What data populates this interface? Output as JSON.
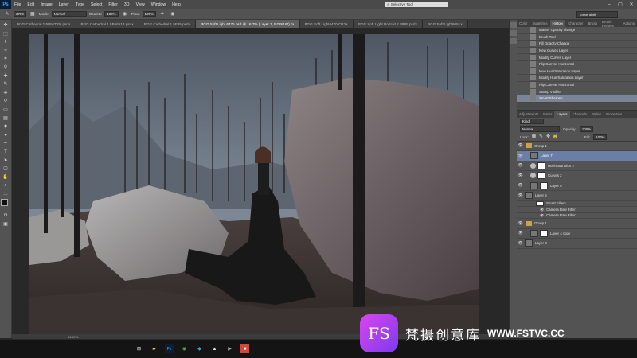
{
  "app": {
    "logo": "Ps",
    "search_placeholder": "Selective Tool"
  },
  "menu": [
    "File",
    "Edit",
    "Image",
    "Layer",
    "Type",
    "Select",
    "Filter",
    "3D",
    "View",
    "Window",
    "Help"
  ],
  "window_controls": [
    "–",
    "▢",
    "✕"
  ],
  "options": {
    "brush_size": "3700",
    "mode_label": "Mode:",
    "mode_value": "Normal",
    "opacity_label": "Opacity:",
    "opacity_value": "100%",
    "flow_label": "Flow:",
    "flow_value": "100%",
    "workspace": "Essentials"
  },
  "tabs": [
    {
      "label": "BGG Cathedral 1 5B56T3ts.psd",
      "active": false
    },
    {
      "label": "BGG Cathedral 1 5B56513.psd",
      "active": false
    },
    {
      "label": "BGG Cathedral 1 5F35.psd",
      "active": false
    },
    {
      "label": "BGG Soft Light 6475.psd @ 16.7% (Layer 7, RGB/16*) *",
      "active": true
    },
    {
      "label": "BGG Soft Light6470.CR2",
      "active": false
    },
    {
      "label": "BGG Soft Light Portrait 2 5B85.psd",
      "active": false
    },
    {
      "label": "BGG Soft Light6051",
      "active": false
    }
  ],
  "status": {
    "zoom": "16.67%"
  },
  "history_panel": {
    "tabs": [
      "Color",
      "Swatches",
      "History",
      "Character",
      "Brush",
      "Brush Presets",
      "Actions"
    ],
    "active_tab": "History",
    "items": [
      {
        "label": "Master Opacity change",
        "selected": false
      },
      {
        "label": "Brush Tool",
        "selected": false
      },
      {
        "label": "Fill Opacity Change",
        "selected": false
      },
      {
        "label": "New Curves Layer",
        "selected": false
      },
      {
        "label": "Modify Curves Layer",
        "selected": false
      },
      {
        "label": "Flip Canvas Horizontal",
        "selected": false
      },
      {
        "label": "New Hue/Saturation Layer",
        "selected": false
      },
      {
        "label": "Modify Hue/Saturation Layer",
        "selected": false
      },
      {
        "label": "Flip Canvas Horizontal",
        "selected": false
      },
      {
        "label": "Stamp Visible",
        "selected": false
      },
      {
        "label": "Smart Sharpen",
        "selected": true
      }
    ]
  },
  "layers_panel": {
    "tabs": [
      "Adjustments",
      "Paths",
      "Layers",
      "Channels",
      "Styles",
      "Properties"
    ],
    "active_tab": "Layers",
    "kind": "Kind",
    "blend_mode": "Normal",
    "opacity_label": "Opacity:",
    "opacity_value": "100%",
    "lock_label": "Lock:",
    "fill_label": "Fill:",
    "fill_value": "100%",
    "layers": [
      {
        "name": "Group 1",
        "type": "group",
        "indent": 0,
        "selected": false
      },
      {
        "name": "Layer 7",
        "type": "pixel",
        "indent": 1,
        "selected": true
      },
      {
        "name": "Hue/Saturation 2",
        "type": "adjustment",
        "indent": 1,
        "selected": false
      },
      {
        "name": "Curves 2",
        "type": "adjustment",
        "indent": 1,
        "selected": false
      },
      {
        "name": "Layer 6",
        "type": "pixel-mask",
        "indent": 1,
        "selected": false
      },
      {
        "name": "Layer 5",
        "type": "pixel",
        "indent": 0,
        "selected": false
      },
      {
        "name": "Smart Filters",
        "type": "sub",
        "indent": 2,
        "selected": false
      },
      {
        "name": "Camera Raw Filter",
        "type": "subfilter",
        "indent": 3,
        "selected": false
      },
      {
        "name": "Camera Raw Filter",
        "type": "subfilter",
        "indent": 3,
        "selected": false
      },
      {
        "name": "Group 1",
        "type": "group",
        "indent": 0,
        "selected": false
      },
      {
        "name": "Layer 4 copy",
        "type": "pixel-mask",
        "indent": 1,
        "selected": false
      },
      {
        "name": "Layer 3",
        "type": "pixel",
        "indent": 0,
        "selected": false
      }
    ]
  },
  "taskbar_icons": [
    "windows-start",
    "file-explorer",
    "photoshop",
    "chrome",
    "lightroom",
    "photos",
    "media-player",
    "app-red"
  ],
  "watermark": {
    "logo_text": "FS",
    "chinese": "梵摄创意库",
    "url": "WWW.FSTVC.CC"
  }
}
